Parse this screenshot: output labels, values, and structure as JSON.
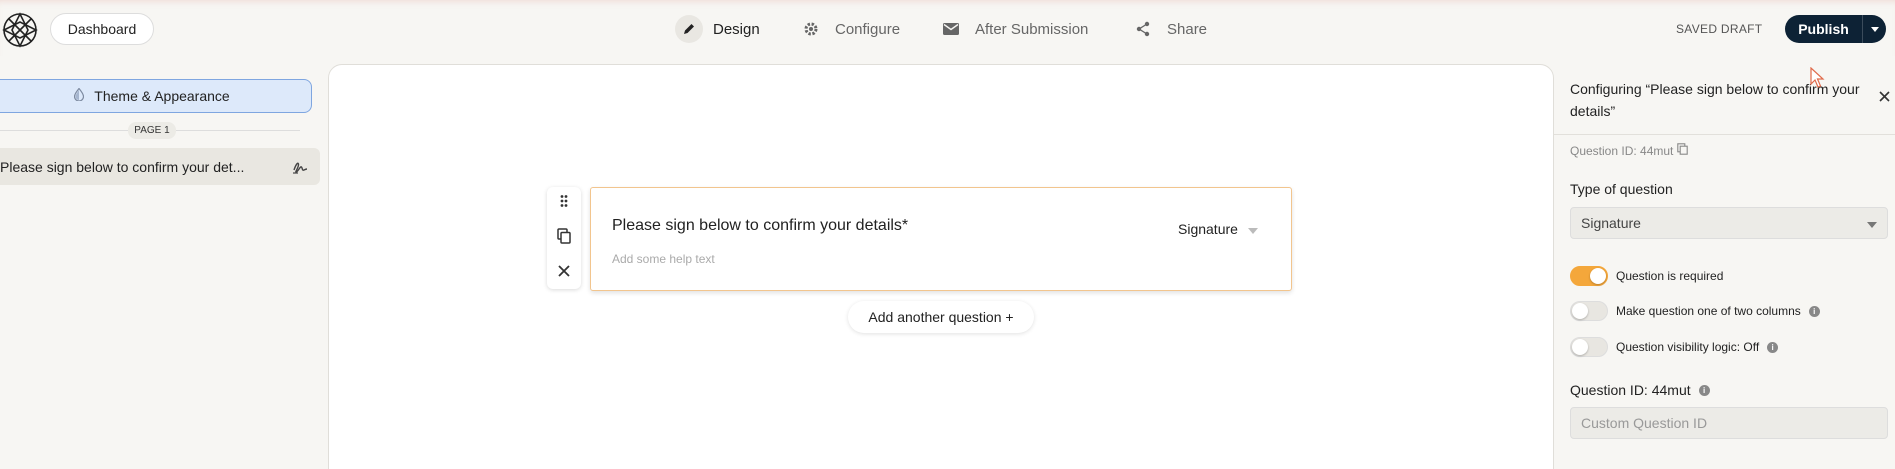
{
  "header": {
    "dashboard_label": "Dashboard",
    "tabs": [
      {
        "label": "Design",
        "icon": "pencil-icon",
        "active": true
      },
      {
        "label": "Configure",
        "icon": "gear-icon",
        "active": false
      },
      {
        "label": "After Submission",
        "icon": "envelope-icon",
        "active": false
      },
      {
        "label": "Share",
        "icon": "share-icon",
        "active": false
      }
    ],
    "status": "SAVED DRAFT",
    "publish_label": "Publish"
  },
  "sidebar": {
    "theme_label": "Theme & Appearance",
    "page_label": "PAGE 1",
    "items": [
      {
        "label": "Please sign below to confirm your det...",
        "icon": "signature-icon"
      }
    ]
  },
  "canvas": {
    "question": {
      "title": "Please sign below to confirm your details*",
      "help_placeholder": "Add some help text",
      "type": "Signature"
    },
    "add_question_label": "Add another question +"
  },
  "panel": {
    "heading": "Configuring “Please sign below to confirm your details”",
    "question_id_small": "Question ID: 44mut",
    "type_label": "Type of question",
    "type_value": "Signature",
    "toggles": [
      {
        "label": "Question is required",
        "on": true
      },
      {
        "label": "Make question one of two columns",
        "on": false
      },
      {
        "label": "Question visibility logic: Off",
        "on": false
      }
    ],
    "question_id_label": "Question ID: 44mut",
    "custom_id_placeholder": "Custom Question ID"
  },
  "colors": {
    "accent": "#f4a73b",
    "publish": "#0d2235",
    "theme_button": "#dde9fa"
  }
}
